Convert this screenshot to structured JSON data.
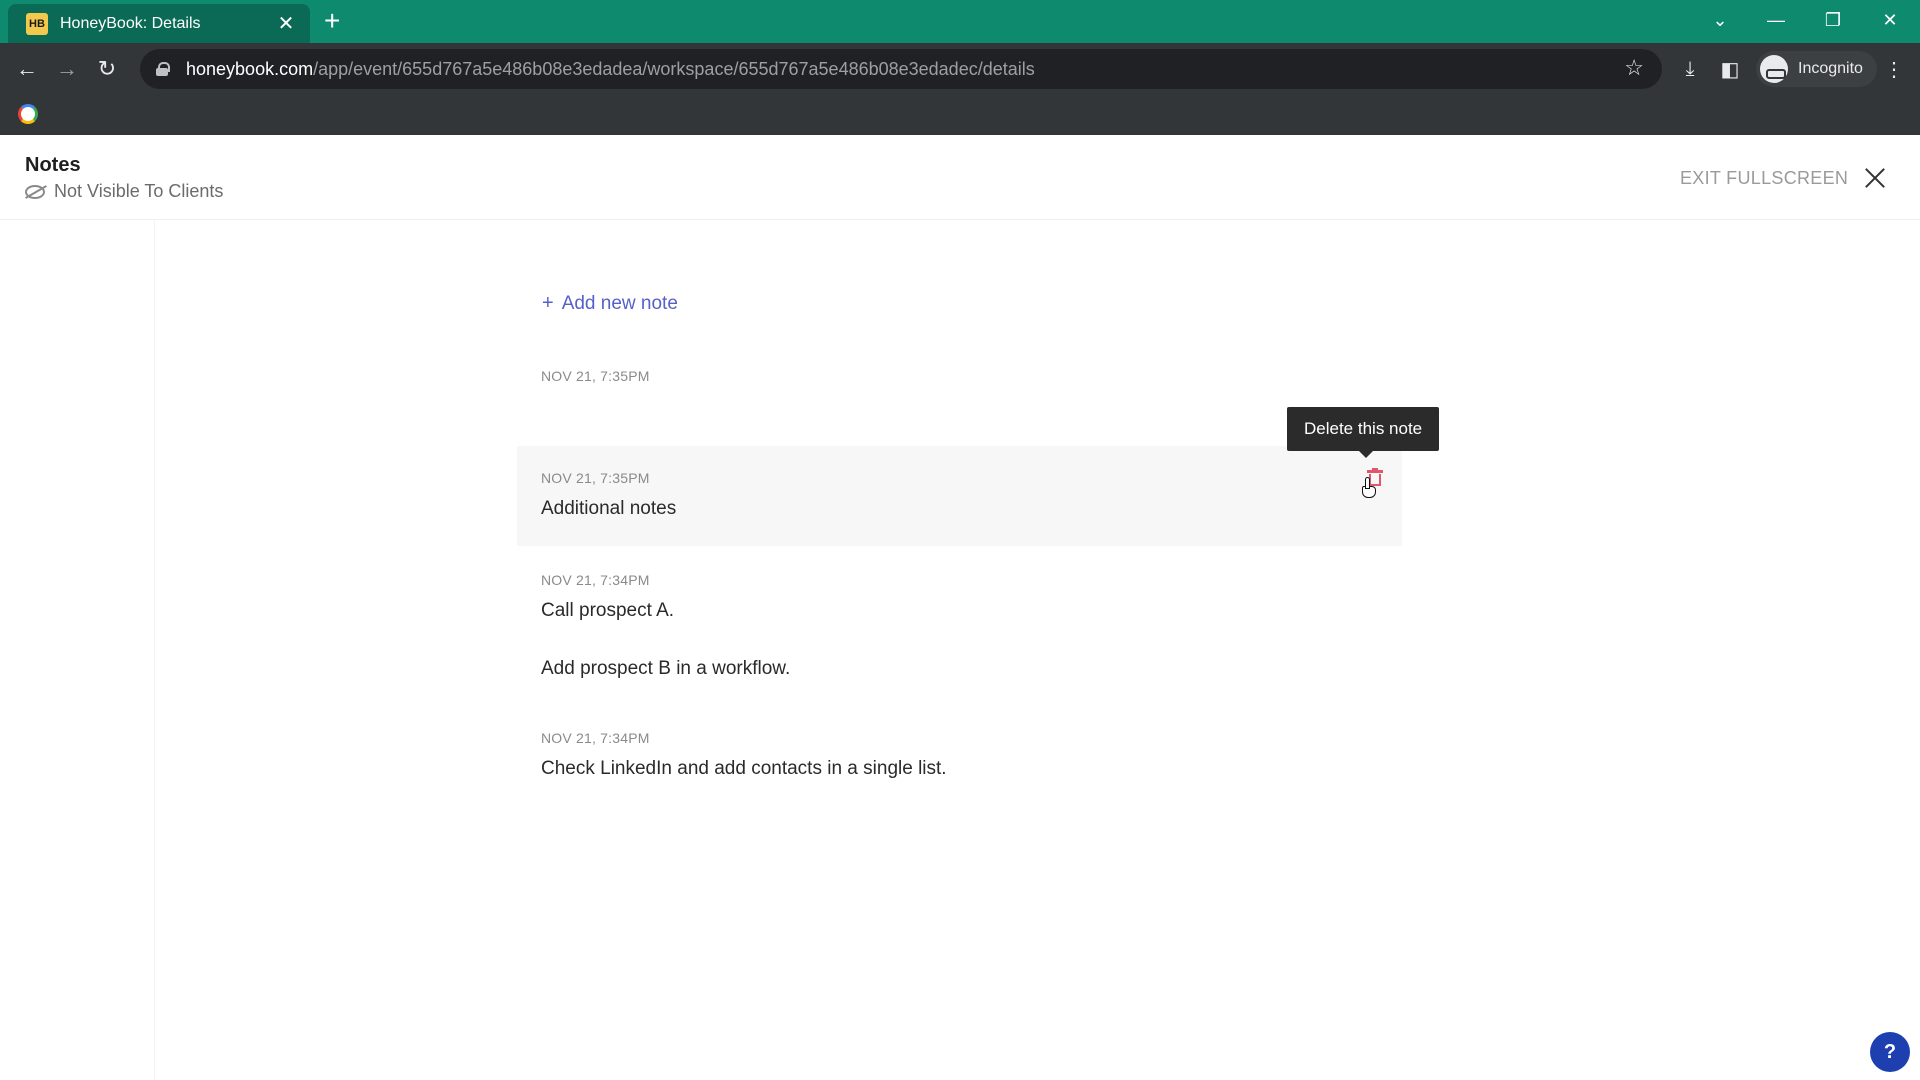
{
  "browser": {
    "tab": {
      "favicon_text": "HB",
      "title": "HoneyBook: Details",
      "close_glyph": "✕"
    },
    "new_tab_glyph": "+",
    "window_controls": {
      "dropdown": "⌄",
      "minimize": "—",
      "restore": "❐",
      "close": "✕"
    },
    "nav": {
      "back": "←",
      "forward": "→",
      "reload": "↻"
    },
    "address": {
      "domain": "honeybook.com",
      "path": "/app/event/655d767a5e486b08e3edadea/workspace/655d767a5e486b08e3edadec/details"
    },
    "star_glyph": "☆",
    "toolbar_icons": {
      "download": "⤓",
      "sidepanel": "◧",
      "menu": "⋮"
    },
    "profile": {
      "label": "Incognito"
    }
  },
  "header": {
    "title": "Notes",
    "visibility_label": "Not Visible To Clients",
    "exit_label": "EXIT FULLSCREEN"
  },
  "main": {
    "add_note_plus": "+",
    "add_note_label": "Add new note",
    "notes": [
      {
        "date": "NOV 21, 7:35PM",
        "lines": []
      },
      {
        "date": "NOV 21, 7:35PM",
        "lines": [
          "Additional notes"
        ]
      },
      {
        "date": "NOV 21, 7:34PM",
        "lines": [
          "Call prospect A.",
          "Add prospect B in a workflow."
        ]
      },
      {
        "date": "NOV 21, 7:34PM",
        "lines": [
          "Check LinkedIn and add contacts in a single list."
        ]
      }
    ],
    "tooltip": "Delete this note"
  },
  "help_glyph": "?",
  "colors": {
    "tabstrip": "#0e8a6f",
    "chrome_toolbar": "#323639",
    "link_accent": "#5561c9",
    "delete_accent": "#e0566b",
    "help_button": "#1d3fb0"
  }
}
